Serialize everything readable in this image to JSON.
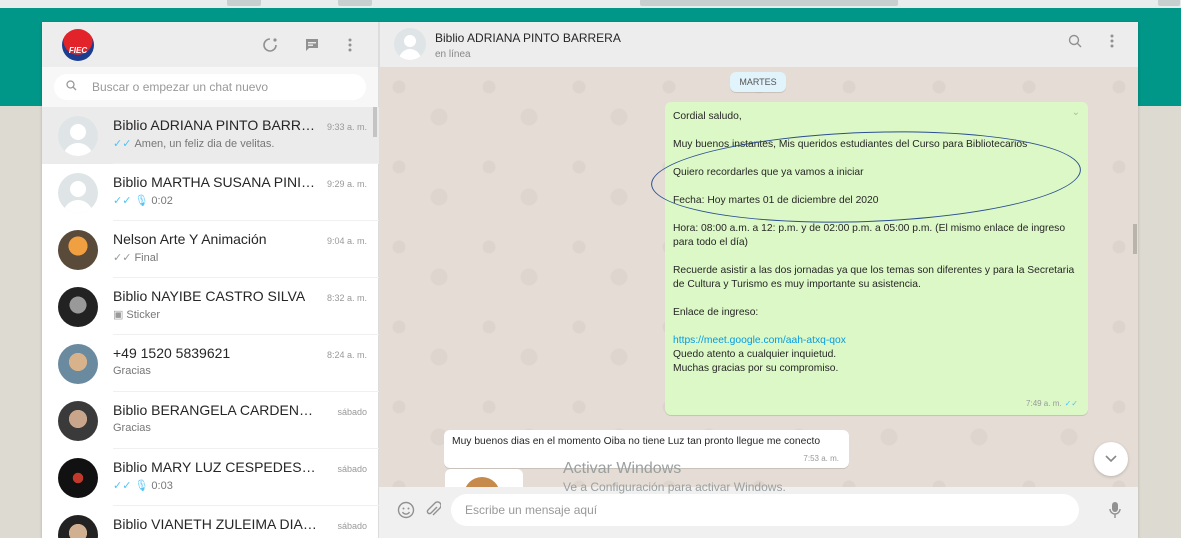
{
  "colors": {
    "brand": "#009688",
    "outgoing_bubble": "#dcf8c6",
    "incoming_bubble": "#ffffff",
    "read_tick": "#4fc3f7",
    "link": "#039be5",
    "annotation_ellipse": "#2b4f91"
  },
  "sidebar": {
    "logo_text": "FIEC",
    "icons": [
      "status-icon",
      "new-chat-icon",
      "menu-icon"
    ],
    "search_placeholder": "Buscar o empezar un chat nuevo",
    "chats": [
      {
        "name": "Biblio ADRIANA PINTO BARRERA",
        "time": "9:33 a. m.",
        "preview": "Amen, un feliz dia de velitas.",
        "status": "read"
      },
      {
        "name": "Biblio MARTHA SUSANA PINILL...",
        "time": "9:29 a. m.",
        "preview": "0:02",
        "status": "read-voice"
      },
      {
        "name": "Nelson Arte Y Animación",
        "time": "9:04 a. m.",
        "preview": "Final",
        "status": "delivered"
      },
      {
        "name": "Biblio NAYIBE CASTRO SILVA",
        "time": "8:32 a. m.",
        "preview": "Sticker",
        "status": "sticker"
      },
      {
        "name": "+49 1520 5839621",
        "time": "8:24 a. m.",
        "preview": "Gracias",
        "status": "none"
      },
      {
        "name": "Biblio BERANGELA CARDENAS VE...",
        "time": "sábado",
        "preview": "Gracias",
        "status": "none"
      },
      {
        "name": "Biblio MARY LUZ CESPEDES SARM...",
        "time": "sábado",
        "preview": "0:03",
        "status": "read-voice"
      },
      {
        "name": "Biblio VIANETH ZULEIMA DIAZ CI...",
        "time": "sábado",
        "preview": "",
        "status": "none"
      }
    ]
  },
  "conversation": {
    "title": "Biblio ADRIANA PINTO BARRERA",
    "subtitle": "en línea",
    "day_label": "MARTES",
    "outgoing": {
      "greeting": "Cordial saludo,",
      "line1": "Muy buenos instantes, Mis queridos estudiantes del Curso para Bibliotecarios",
      "line2": "Quiero recordarles que ya vamos a iniciar",
      "line3": "Fecha: Hoy martes 01 de diciembre del 2020",
      "line4": "Hora:  08:00 a.m. a 12: p.m. y de 02:00 p.m. a 05:00 p.m. (El mismo enlace de ingreso para todo el día)",
      "line5": "Recuerde asistir a las dos jornadas ya que los temas son diferentes y para la Secretaria de Cultura y Turismo es muy importante su asistencia.",
      "line6": "Enlace de ingreso:",
      "link": "https://meet.google.com/aah-atxq-qox",
      "line7": "Quedo atento a cualquier inquietud.",
      "line8": "Muchas gracias por su compromiso.",
      "time": "7:49 a. m."
    },
    "incoming": {
      "text": "Muy buenos dias en el momento Oiba no tiene Luz tan pronto llegue me conecto",
      "time": "7:53 a. m."
    },
    "composer_placeholder": "Escribe un mensaje aquí",
    "watermark_title": "Activar Windows",
    "watermark_sub": "Ve a Configuración para activar Windows."
  }
}
